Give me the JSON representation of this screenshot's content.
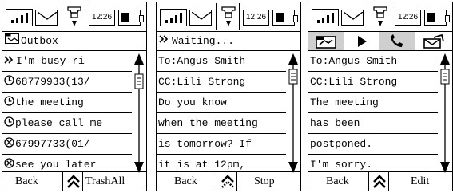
{
  "screens": [
    {
      "status": {
        "time": "12:26"
      },
      "title": "Outbox",
      "lines": [
        "I'm busy ri",
        "68779933(13/",
        "the meeting",
        "please call me",
        "67997733(01/",
        "see you later"
      ],
      "softkeys": {
        "left": "Back",
        "right": "TrashAll"
      }
    },
    {
      "status": {
        "time": "12:26"
      },
      "title": "Waiting...",
      "lines": [
        "To:Angus Smith",
        "CC:Lili Strong",
        "Do you know",
        "when the meeting",
        "is tomorrow? If",
        "it is at 12pm,"
      ],
      "softkeys": {
        "left": "Back",
        "right": "Stop"
      }
    },
    {
      "status": {
        "time": "12:26"
      },
      "lines": [
        "To:Angus Smith",
        "CC:Lili Strong",
        "The meeting",
        "has been",
        "postponed.",
        "I'm sorry."
      ],
      "softkeys": {
        "left": "Back",
        "right": "Edit"
      }
    }
  ]
}
